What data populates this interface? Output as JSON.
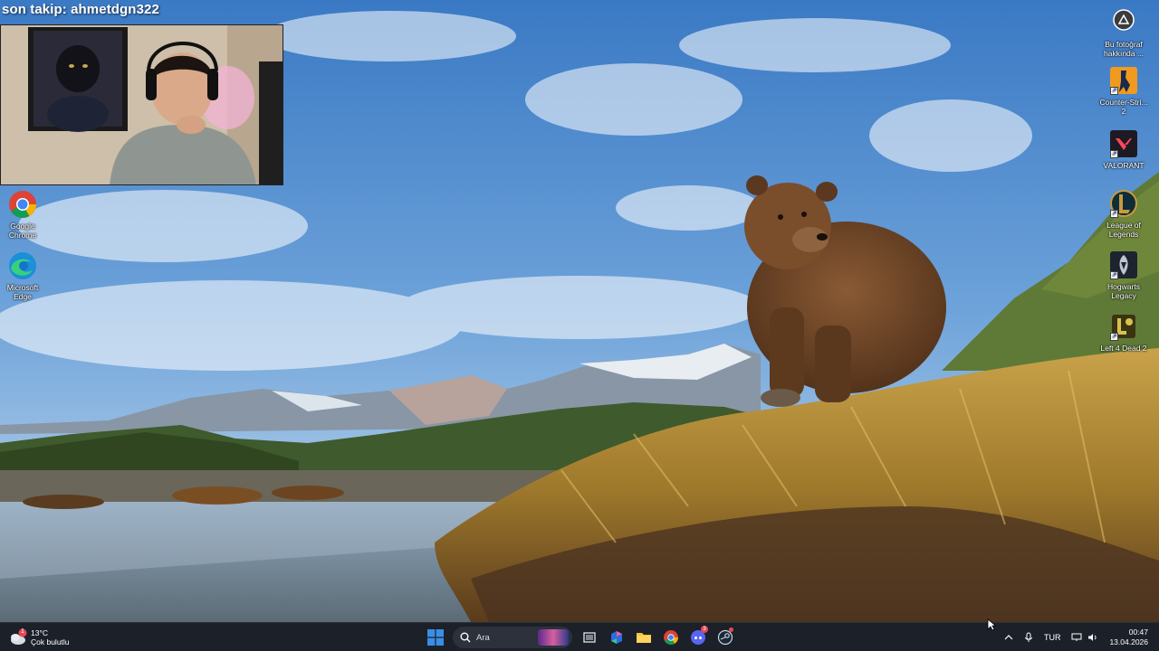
{
  "stream_overlay": {
    "follow_text": "son takip: ahmetdgn322"
  },
  "desktop_icons_left": [
    {
      "label": "Google\nChrome",
      "icon": "chrome-icon"
    },
    {
      "label": "Microsoft\nEdge",
      "icon": "edge-icon"
    }
  ],
  "desktop_icons_right": [
    {
      "label": "Bu fotoğraf\nhakkında ...",
      "icon": "about-photo-icon"
    },
    {
      "label": "Counter-Stri...\n2",
      "icon": "counter-strike-icon"
    },
    {
      "label": "VALORANT",
      "icon": "valorant-icon"
    },
    {
      "label": "League of\nLegends",
      "icon": "league-of-legends-icon"
    },
    {
      "label": "Hogwarts\nLegacy",
      "icon": "hogwarts-legacy-icon"
    },
    {
      "label": "Left 4 Dead 2",
      "icon": "left-4-dead-2-icon"
    }
  ],
  "taskbar": {
    "weather": {
      "temp": "13°C",
      "condition": "Çok bulutlu",
      "badge": "1"
    },
    "search_placeholder": "Ara",
    "pinned": [
      "widgets-icon",
      "task-view-icon",
      "microsoft-365-icon",
      "file-explorer-icon",
      "chrome-icon",
      "discord-icon",
      "steam-icon"
    ],
    "discord_badge": "3",
    "language": "TUR",
    "time": "00:47",
    "date": "13.04.2026"
  },
  "colors": {
    "taskbar_bg": "#1c2029",
    "sky_top": "#3f7fc9",
    "windows_blue": "#3a8ee6"
  }
}
